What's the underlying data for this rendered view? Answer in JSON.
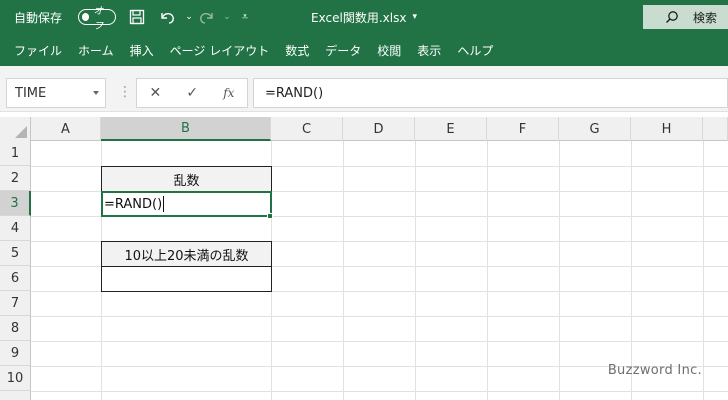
{
  "titlebar": {
    "autosave_label": "自動保存",
    "autosave_state": "オフ",
    "filename": "Excel関数用.xlsx",
    "filename_caret": "▾",
    "search_label": "検索"
  },
  "quick_access": {
    "save_icon": "save-icon",
    "undo_icon": "undo-icon",
    "redo_icon": "redo-icon",
    "customize_icon": "customize-icon"
  },
  "ribbon": {
    "tabs": [
      "ファイル",
      "ホーム",
      "挿入",
      "ページ レイアウト",
      "数式",
      "データ",
      "校閲",
      "表示",
      "ヘルプ"
    ]
  },
  "formula_bar": {
    "name_box": "TIME",
    "cancel": "✕",
    "enter": "✓",
    "fx": "fx",
    "formula": "=RAND()"
  },
  "sheet": {
    "columns": [
      "A",
      "B",
      "C",
      "D",
      "E",
      "F",
      "G",
      "H"
    ],
    "rows": [
      "1",
      "2",
      "3",
      "4",
      "5",
      "6",
      "7",
      "8",
      "9",
      "10"
    ],
    "active_column": "B",
    "active_row": "3",
    "cells": {
      "b2": "乱数",
      "b3": "=RAND()",
      "b5": "10以上20未満の乱数",
      "b6": ""
    }
  },
  "watermark": "Buzzword Inc.",
  "colors": {
    "excel_green": "#217346",
    "header_bg": "#f0f0f0",
    "gridline": "#e1e1e1"
  }
}
